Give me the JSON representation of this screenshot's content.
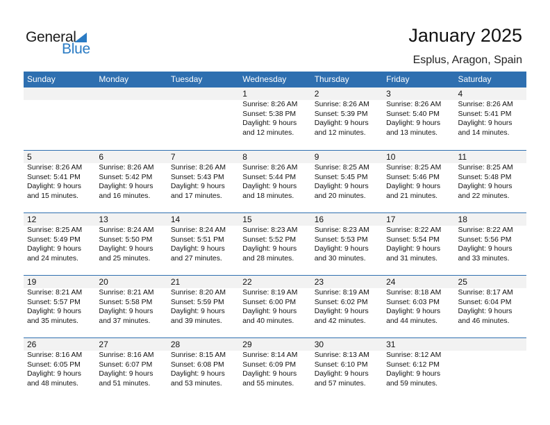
{
  "logo": {
    "word1": "General",
    "word2": "Blue"
  },
  "header": {
    "title": "January 2025",
    "location": "Esplus, Aragon, Spain"
  },
  "colors": {
    "accent": "#2e6fb0",
    "logo_blue": "#2a7bc4",
    "date_band": "#f2f2f2"
  },
  "weekdays": [
    "Sunday",
    "Monday",
    "Tuesday",
    "Wednesday",
    "Thursday",
    "Friday",
    "Saturday"
  ],
  "weeks": [
    [
      null,
      null,
      null,
      {
        "day": "1",
        "sunrise": "Sunrise: 8:26 AM",
        "sunset": "Sunset: 5:38 PM",
        "daylight1": "Daylight: 9 hours",
        "daylight2": "and 12 minutes."
      },
      {
        "day": "2",
        "sunrise": "Sunrise: 8:26 AM",
        "sunset": "Sunset: 5:39 PM",
        "daylight1": "Daylight: 9 hours",
        "daylight2": "and 12 minutes."
      },
      {
        "day": "3",
        "sunrise": "Sunrise: 8:26 AM",
        "sunset": "Sunset: 5:40 PM",
        "daylight1": "Daylight: 9 hours",
        "daylight2": "and 13 minutes."
      },
      {
        "day": "4",
        "sunrise": "Sunrise: 8:26 AM",
        "sunset": "Sunset: 5:41 PM",
        "daylight1": "Daylight: 9 hours",
        "daylight2": "and 14 minutes."
      }
    ],
    [
      {
        "day": "5",
        "sunrise": "Sunrise: 8:26 AM",
        "sunset": "Sunset: 5:41 PM",
        "daylight1": "Daylight: 9 hours",
        "daylight2": "and 15 minutes."
      },
      {
        "day": "6",
        "sunrise": "Sunrise: 8:26 AM",
        "sunset": "Sunset: 5:42 PM",
        "daylight1": "Daylight: 9 hours",
        "daylight2": "and 16 minutes."
      },
      {
        "day": "7",
        "sunrise": "Sunrise: 8:26 AM",
        "sunset": "Sunset: 5:43 PM",
        "daylight1": "Daylight: 9 hours",
        "daylight2": "and 17 minutes."
      },
      {
        "day": "8",
        "sunrise": "Sunrise: 8:26 AM",
        "sunset": "Sunset: 5:44 PM",
        "daylight1": "Daylight: 9 hours",
        "daylight2": "and 18 minutes."
      },
      {
        "day": "9",
        "sunrise": "Sunrise: 8:25 AM",
        "sunset": "Sunset: 5:45 PM",
        "daylight1": "Daylight: 9 hours",
        "daylight2": "and 20 minutes."
      },
      {
        "day": "10",
        "sunrise": "Sunrise: 8:25 AM",
        "sunset": "Sunset: 5:46 PM",
        "daylight1": "Daylight: 9 hours",
        "daylight2": "and 21 minutes."
      },
      {
        "day": "11",
        "sunrise": "Sunrise: 8:25 AM",
        "sunset": "Sunset: 5:48 PM",
        "daylight1": "Daylight: 9 hours",
        "daylight2": "and 22 minutes."
      }
    ],
    [
      {
        "day": "12",
        "sunrise": "Sunrise: 8:25 AM",
        "sunset": "Sunset: 5:49 PM",
        "daylight1": "Daylight: 9 hours",
        "daylight2": "and 24 minutes."
      },
      {
        "day": "13",
        "sunrise": "Sunrise: 8:24 AM",
        "sunset": "Sunset: 5:50 PM",
        "daylight1": "Daylight: 9 hours",
        "daylight2": "and 25 minutes."
      },
      {
        "day": "14",
        "sunrise": "Sunrise: 8:24 AM",
        "sunset": "Sunset: 5:51 PM",
        "daylight1": "Daylight: 9 hours",
        "daylight2": "and 27 minutes."
      },
      {
        "day": "15",
        "sunrise": "Sunrise: 8:23 AM",
        "sunset": "Sunset: 5:52 PM",
        "daylight1": "Daylight: 9 hours",
        "daylight2": "and 28 minutes."
      },
      {
        "day": "16",
        "sunrise": "Sunrise: 8:23 AM",
        "sunset": "Sunset: 5:53 PM",
        "daylight1": "Daylight: 9 hours",
        "daylight2": "and 30 minutes."
      },
      {
        "day": "17",
        "sunrise": "Sunrise: 8:22 AM",
        "sunset": "Sunset: 5:54 PM",
        "daylight1": "Daylight: 9 hours",
        "daylight2": "and 31 minutes."
      },
      {
        "day": "18",
        "sunrise": "Sunrise: 8:22 AM",
        "sunset": "Sunset: 5:56 PM",
        "daylight1": "Daylight: 9 hours",
        "daylight2": "and 33 minutes."
      }
    ],
    [
      {
        "day": "19",
        "sunrise": "Sunrise: 8:21 AM",
        "sunset": "Sunset: 5:57 PM",
        "daylight1": "Daylight: 9 hours",
        "daylight2": "and 35 minutes."
      },
      {
        "day": "20",
        "sunrise": "Sunrise: 8:21 AM",
        "sunset": "Sunset: 5:58 PM",
        "daylight1": "Daylight: 9 hours",
        "daylight2": "and 37 minutes."
      },
      {
        "day": "21",
        "sunrise": "Sunrise: 8:20 AM",
        "sunset": "Sunset: 5:59 PM",
        "daylight1": "Daylight: 9 hours",
        "daylight2": "and 39 minutes."
      },
      {
        "day": "22",
        "sunrise": "Sunrise: 8:19 AM",
        "sunset": "Sunset: 6:00 PM",
        "daylight1": "Daylight: 9 hours",
        "daylight2": "and 40 minutes."
      },
      {
        "day": "23",
        "sunrise": "Sunrise: 8:19 AM",
        "sunset": "Sunset: 6:02 PM",
        "daylight1": "Daylight: 9 hours",
        "daylight2": "and 42 minutes."
      },
      {
        "day": "24",
        "sunrise": "Sunrise: 8:18 AM",
        "sunset": "Sunset: 6:03 PM",
        "daylight1": "Daylight: 9 hours",
        "daylight2": "and 44 minutes."
      },
      {
        "day": "25",
        "sunrise": "Sunrise: 8:17 AM",
        "sunset": "Sunset: 6:04 PM",
        "daylight1": "Daylight: 9 hours",
        "daylight2": "and 46 minutes."
      }
    ],
    [
      {
        "day": "26",
        "sunrise": "Sunrise: 8:16 AM",
        "sunset": "Sunset: 6:05 PM",
        "daylight1": "Daylight: 9 hours",
        "daylight2": "and 48 minutes."
      },
      {
        "day": "27",
        "sunrise": "Sunrise: 8:16 AM",
        "sunset": "Sunset: 6:07 PM",
        "daylight1": "Daylight: 9 hours",
        "daylight2": "and 51 minutes."
      },
      {
        "day": "28",
        "sunrise": "Sunrise: 8:15 AM",
        "sunset": "Sunset: 6:08 PM",
        "daylight1": "Daylight: 9 hours",
        "daylight2": "and 53 minutes."
      },
      {
        "day": "29",
        "sunrise": "Sunrise: 8:14 AM",
        "sunset": "Sunset: 6:09 PM",
        "daylight1": "Daylight: 9 hours",
        "daylight2": "and 55 minutes."
      },
      {
        "day": "30",
        "sunrise": "Sunrise: 8:13 AM",
        "sunset": "Sunset: 6:10 PM",
        "daylight1": "Daylight: 9 hours",
        "daylight2": "and 57 minutes."
      },
      {
        "day": "31",
        "sunrise": "Sunrise: 8:12 AM",
        "sunset": "Sunset: 6:12 PM",
        "daylight1": "Daylight: 9 hours",
        "daylight2": "and 59 minutes."
      },
      null
    ]
  ]
}
